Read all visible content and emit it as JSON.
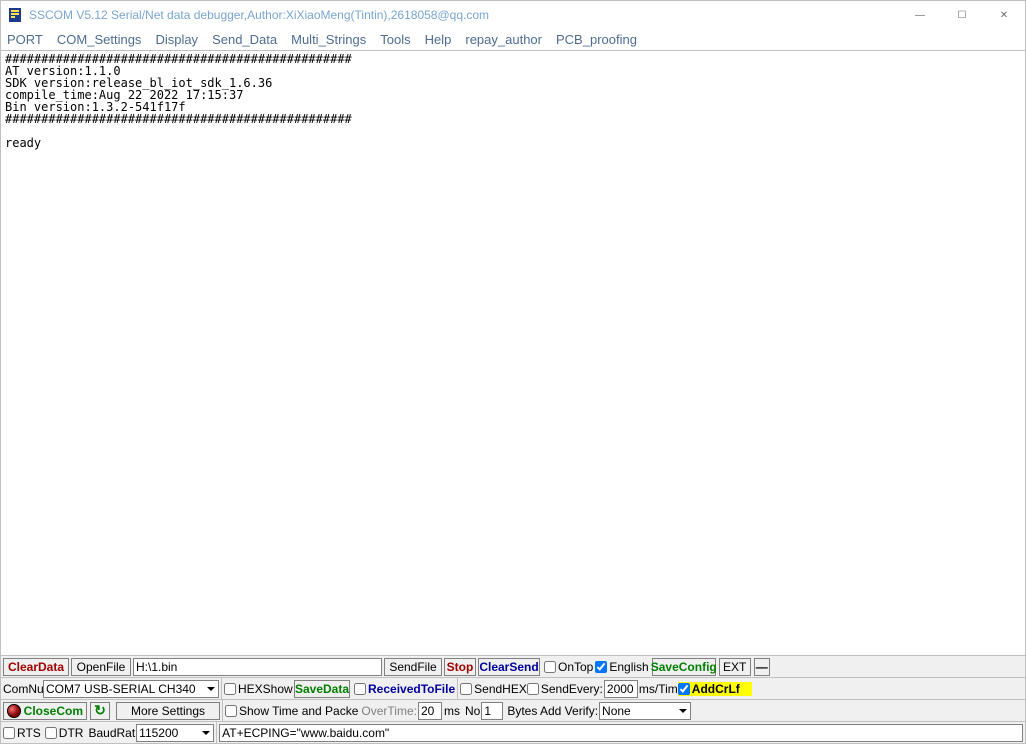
{
  "window": {
    "title": "SSCOM V5.12 Serial/Net data debugger,Author:XiXiaoMeng(Tintin),2618058@qq.com"
  },
  "menu": {
    "port": "PORT",
    "com_settings": "COM_Settings",
    "display": "Display",
    "send_data": "Send_Data",
    "multi_strings": "Multi_Strings",
    "tools": "Tools",
    "help": "Help",
    "repay_author": "repay_author",
    "pcb_proofing": "PCB_proofing"
  },
  "terminal_output": "################################################\nAT version:1.1.0\nSDK version:release_bl_iot_sdk_1.6.36\ncompile_time:Aug 22 2022 17:15:37\nBin version:1.3.2-541f17f\n################################################\n\nready",
  "row1": {
    "clear_data": "ClearData",
    "open_file": "OpenFile",
    "file_path": "H:\\1.bin",
    "send_file": "SendFile",
    "stop": "Stop",
    "clear_send": "ClearSend",
    "on_top": "OnTop",
    "english": "English",
    "save_config": "SaveConfig",
    "ext": "EXT",
    "toggle": "—"
  },
  "row2": {
    "comnum": "ComNum",
    "com_value": "COM7 USB-SERIAL CH340",
    "hex_show": "HEXShow",
    "save_data": "SaveData",
    "received_to_file": "ReceivedToFile",
    "send_hex": "SendHEX",
    "send_every": "SendEvery:",
    "send_every_val": "2000",
    "ms_tim": "ms/Tim",
    "add_crlf": "AddCrLf"
  },
  "row3": {
    "close_com": "CloseCom",
    "more_settings": "More Settings",
    "show_time": "Show Time and Packe",
    "over_time": "OverTime:",
    "over_time_val": "20",
    "ms": "ms",
    "no": "No",
    "no_val": "1",
    "bytes_verify": "Bytes Add Verify:",
    "verify_value": "None"
  },
  "row4": {
    "rts": "RTS",
    "dtr": "DTR",
    "baud": "BaudRat",
    "baud_value": "115200",
    "command": "AT+ECPING=\"www.baidu.com\""
  }
}
